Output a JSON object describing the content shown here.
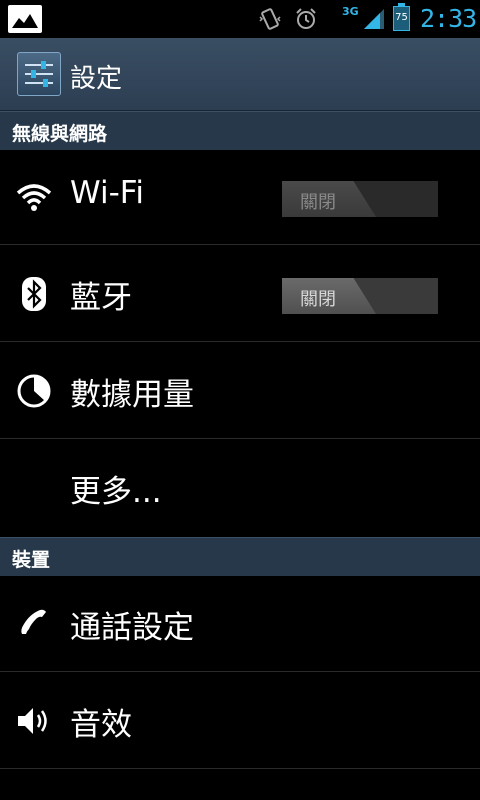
{
  "status_bar": {
    "network": "3G",
    "battery": "75",
    "time": "2:33"
  },
  "action_bar": {
    "title": "設定"
  },
  "sections": [
    {
      "header": "無線與網路",
      "items": [
        {
          "label": "Wi-Fi",
          "toggle": "關閉",
          "icon": "wifi-icon"
        },
        {
          "label": "藍牙",
          "toggle": "關閉",
          "icon": "bluetooth-icon"
        },
        {
          "label": "數據用量",
          "icon": "data-usage-icon"
        },
        {
          "label": "更多..."
        }
      ]
    },
    {
      "header": "裝置",
      "items": [
        {
          "label": "通話設定",
          "icon": "phone-icon"
        },
        {
          "label": "音效",
          "icon": "speaker-icon"
        }
      ]
    }
  ],
  "colors": {
    "accent": "#33b5e5",
    "section_header_bg": "#26384a",
    "action_bar_bg": "#34475b"
  }
}
